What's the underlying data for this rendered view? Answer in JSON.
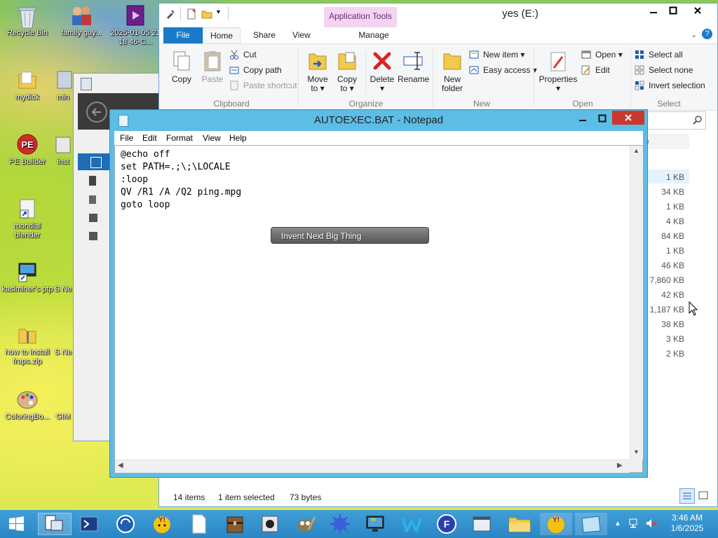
{
  "desktop": {
    "icons": [
      {
        "label": "Recycle Bin",
        "icon": "recycle-bin-icon"
      },
      {
        "label": "family guy...",
        "icon": "people-icon"
      },
      {
        "label": "2025-01-05 21 18 46-C...",
        "icon": "video-file-icon"
      },
      {
        "label": "mydick",
        "icon": "folder-icon"
      },
      {
        "label": "min",
        "icon": "folder-icon"
      },
      {
        "label": "PE Builder",
        "icon": "pe-builder-icon"
      },
      {
        "label": "inst",
        "icon": "installer-icon"
      },
      {
        "label": "mondial blender",
        "icon": "shortcut-icon"
      },
      {
        "label": "kaslminer's ptp",
        "icon": "shortcut-icon"
      },
      {
        "label": "S Ne",
        "icon": "shortcut-icon"
      },
      {
        "label": "how to install fraps.zip",
        "icon": "zip-icon"
      },
      {
        "label": "S Ne",
        "icon": "shortcut-icon"
      },
      {
        "label": "ColoringBo...",
        "icon": "palette-icon"
      },
      {
        "label": "GIM",
        "icon": "gimp-icon"
      }
    ]
  },
  "explorer": {
    "title": "yes (E:)",
    "context_tab": "Application Tools",
    "tabs": [
      "File",
      "Home",
      "Share",
      "View",
      "Manage"
    ],
    "clipboard": {
      "copy": "Copy",
      "paste": "Paste",
      "cut": "Cut",
      "copy_path": "Copy path",
      "paste_shortcut": "Paste shortcut",
      "group": "Clipboard"
    },
    "organize": {
      "move_to_1": "Move",
      "move_to_2": "to ▾",
      "copy_to_1": "Copy",
      "copy_to_2": "to ▾",
      "delete": "Delete",
      "delete_arrow": "▾",
      "rename": "Rename",
      "group": "Organize"
    },
    "new": {
      "new_folder_1": "New",
      "new_folder_2": "folder",
      "new_item": "New item ▾",
      "easy_access": "Easy access ▾",
      "group": "New"
    },
    "open": {
      "properties": "Properties",
      "properties_arrow": "▾",
      "open": "Open ▾",
      "edit": "Edit",
      "group": "Open"
    },
    "select": {
      "select_all": "Select all",
      "select_none": "Select none",
      "invert": "Invert selection",
      "group": "Select"
    },
    "search_placeholder": "e",
    "sizes": [
      "1 KB",
      "34 KB",
      "1 KB",
      "4 KB",
      "84 KB",
      "1 KB",
      "46 KB",
      "7,860 KB",
      "42 KB",
      "1,187 KB",
      "38 KB",
      "3 KB",
      "2 KB"
    ],
    "status": {
      "items": "14 items",
      "selected": "1 item selected",
      "bytes": "73 bytes"
    }
  },
  "notepad": {
    "title": "AUTOEXEC.BAT - Notepad",
    "menu": [
      "File",
      "Edit",
      "Format",
      "View",
      "Help"
    ],
    "content": "@echo off\nset PATH=.;\\;\\LOCALE\n:loop\nQV /R1 /A /Q2 ping.mpg\ngoto loop",
    "tooltip": "Invent Next Big Thing"
  },
  "taskbar": {
    "clock_time": "3:46 AM",
    "clock_date": "1/6/2025"
  },
  "colors": {
    "notepad_frame": "#5cbde6",
    "taskbar": "#2a86c4",
    "ribbon_file_tab": "#1979ca",
    "context_tab": "#f3d4f3"
  }
}
